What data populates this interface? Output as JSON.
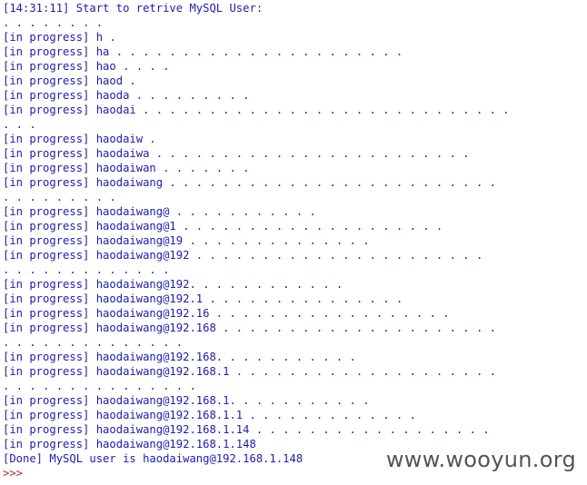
{
  "console": {
    "lines": [
      "[14:31:11] Start to retrive MySQL User:",
      ". . . . . . . .",
      "[in progress] h .",
      "[in progress] ha . . . . . . . . . . . . . . . . . . . . . .",
      "[in progress] hao . . . .",
      "[in progress] haod .",
      "[in progress] haoda . . . . . . . . .",
      "[in progress] haodai . . . . . . . . . . . . . . . . . . . . . . . . . . . .",
      ". . .",
      "[in progress] haodaiw .",
      "[in progress] haodaiwa . . . . . . . . . . . . . . . . . . . . . . . .",
      "[in progress] haodaiwan . . . . . . .",
      "[in progress] haodaiwang . . . . . . . . . . . . . . . . . . . . . . . . .",
      ". . . . . . . . .",
      "[in progress] haodaiwang@ . . . . . . . . . . .",
      "[in progress] haodaiwang@1 . . . . . . . . . . . . . . . . . . . .",
      "[in progress] haodaiwang@19 . . . . . . . . . . . . . .",
      "[in progress] haodaiwang@192 . . . . . . . . . . . . . . . . . . . . . .",
      ". . . . . . . . . . . . .",
      "[in progress] haodaiwang@192. . . . . . . . . . . .",
      "[in progress] haodaiwang@192.1 . . . . . . . . . . . . . . .",
      "[in progress] haodaiwang@192.16 . . . . . . . . . . . . . . . . . .",
      "[in progress] haodaiwang@192.168 . . . . . . . . . . . . . . . . . . . . .",
      ". . . . . . . . . . . . . .",
      "[in progress] haodaiwang@192.168. . . . . . . . . . .",
      "[in progress] haodaiwang@192.168.1 . . . . . . . . . . . . . . . . . . . .",
      ". . . . . . . . . . . . . . .",
      "[in progress] haodaiwang@192.168.1. . . . . . . . . . .",
      "[in progress] haodaiwang@192.168.1.1 . . . . . . . . . . . . .",
      "[in progress] haodaiwang@192.168.1.14 . . . . . . . . . . . . . . . . . .",
      "[in progress] haodaiwang@192.168.1.148",
      "[Done] MySQL user is haodaiwang@192.168.1.148"
    ],
    "prompt": ">>>",
    "text_color": "#1c1cb0",
    "prompt_color": "#c02424"
  },
  "watermark": {
    "text": "www.wooyun.org"
  }
}
